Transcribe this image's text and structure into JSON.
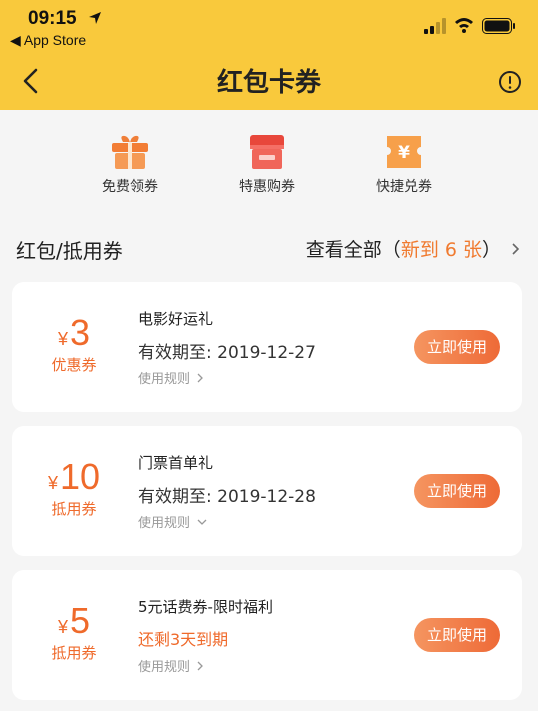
{
  "status_bar": {
    "time": "09:15",
    "back_app": "◀ App Store",
    "icons": [
      "location-arrow-icon",
      "signal-icon",
      "wifi-icon",
      "battery-icon"
    ]
  },
  "nav": {
    "title": "红包卡券",
    "back_icon": "chevron-left-icon",
    "info_icon": "exclamation-circle-icon"
  },
  "quick_actions": [
    {
      "label": "免费领券",
      "icon": "gift-icon"
    },
    {
      "label": "特惠购券",
      "icon": "store-icon"
    },
    {
      "label": "快捷兑券",
      "icon": "yuan-ticket-icon"
    }
  ],
  "section": {
    "title": "红包/抵用券",
    "view_all_prefix": "查看全部（",
    "new_text": "新到 6 张",
    "view_all_suffix": "）"
  },
  "coupons": [
    {
      "currency": "¥",
      "amount": "3",
      "type": "优惠券",
      "title": "电影好运礼",
      "validity": "有效期至: 2019-12-27",
      "rules": "使用规则",
      "button": "立即使用",
      "rules_icon": "chevron-right-icon"
    },
    {
      "currency": "¥",
      "amount": "10",
      "type": "抵用券",
      "title": "门票首单礼",
      "validity": "有效期至: 2019-12-28",
      "rules": "使用规则",
      "button": "立即使用",
      "rules_icon": "chevron-down-icon"
    },
    {
      "currency": "¥",
      "amount": "5",
      "type": "抵用券",
      "title": "5元话费券-限时福利",
      "validity": "还剩3天到期",
      "rules": "使用规则",
      "button": "立即使用",
      "rules_icon": "chevron-right-icon"
    }
  ],
  "colors": {
    "header": "#f9c93c",
    "accent": "#ef6a2b",
    "background": "#f5f5f5"
  }
}
